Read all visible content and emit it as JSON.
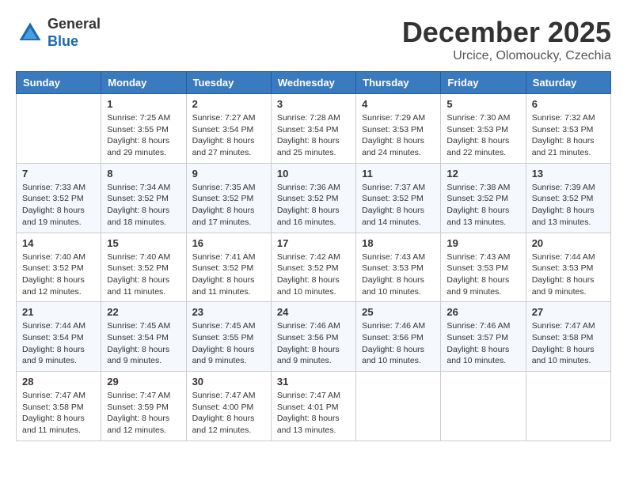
{
  "header": {
    "logo_general": "General",
    "logo_blue": "Blue",
    "month": "December 2025",
    "location": "Urcice, Olomoucky, Czechia"
  },
  "days_of_week": [
    "Sunday",
    "Monday",
    "Tuesday",
    "Wednesday",
    "Thursday",
    "Friday",
    "Saturday"
  ],
  "weeks": [
    [
      {
        "num": "",
        "info": ""
      },
      {
        "num": "1",
        "info": "Sunrise: 7:25 AM\nSunset: 3:55 PM\nDaylight: 8 hours\nand 29 minutes."
      },
      {
        "num": "2",
        "info": "Sunrise: 7:27 AM\nSunset: 3:54 PM\nDaylight: 8 hours\nand 27 minutes."
      },
      {
        "num": "3",
        "info": "Sunrise: 7:28 AM\nSunset: 3:54 PM\nDaylight: 8 hours\nand 25 minutes."
      },
      {
        "num": "4",
        "info": "Sunrise: 7:29 AM\nSunset: 3:53 PM\nDaylight: 8 hours\nand 24 minutes."
      },
      {
        "num": "5",
        "info": "Sunrise: 7:30 AM\nSunset: 3:53 PM\nDaylight: 8 hours\nand 22 minutes."
      },
      {
        "num": "6",
        "info": "Sunrise: 7:32 AM\nSunset: 3:53 PM\nDaylight: 8 hours\nand 21 minutes."
      }
    ],
    [
      {
        "num": "7",
        "info": "Sunrise: 7:33 AM\nSunset: 3:52 PM\nDaylight: 8 hours\nand 19 minutes."
      },
      {
        "num": "8",
        "info": "Sunrise: 7:34 AM\nSunset: 3:52 PM\nDaylight: 8 hours\nand 18 minutes."
      },
      {
        "num": "9",
        "info": "Sunrise: 7:35 AM\nSunset: 3:52 PM\nDaylight: 8 hours\nand 17 minutes."
      },
      {
        "num": "10",
        "info": "Sunrise: 7:36 AM\nSunset: 3:52 PM\nDaylight: 8 hours\nand 16 minutes."
      },
      {
        "num": "11",
        "info": "Sunrise: 7:37 AM\nSunset: 3:52 PM\nDaylight: 8 hours\nand 14 minutes."
      },
      {
        "num": "12",
        "info": "Sunrise: 7:38 AM\nSunset: 3:52 PM\nDaylight: 8 hours\nand 13 minutes."
      },
      {
        "num": "13",
        "info": "Sunrise: 7:39 AM\nSunset: 3:52 PM\nDaylight: 8 hours\nand 13 minutes."
      }
    ],
    [
      {
        "num": "14",
        "info": "Sunrise: 7:40 AM\nSunset: 3:52 PM\nDaylight: 8 hours\nand 12 minutes."
      },
      {
        "num": "15",
        "info": "Sunrise: 7:40 AM\nSunset: 3:52 PM\nDaylight: 8 hours\nand 11 minutes."
      },
      {
        "num": "16",
        "info": "Sunrise: 7:41 AM\nSunset: 3:52 PM\nDaylight: 8 hours\nand 11 minutes."
      },
      {
        "num": "17",
        "info": "Sunrise: 7:42 AM\nSunset: 3:52 PM\nDaylight: 8 hours\nand 10 minutes."
      },
      {
        "num": "18",
        "info": "Sunrise: 7:43 AM\nSunset: 3:53 PM\nDaylight: 8 hours\nand 10 minutes."
      },
      {
        "num": "19",
        "info": "Sunrise: 7:43 AM\nSunset: 3:53 PM\nDaylight: 8 hours\nand 9 minutes."
      },
      {
        "num": "20",
        "info": "Sunrise: 7:44 AM\nSunset: 3:53 PM\nDaylight: 8 hours\nand 9 minutes."
      }
    ],
    [
      {
        "num": "21",
        "info": "Sunrise: 7:44 AM\nSunset: 3:54 PM\nDaylight: 8 hours\nand 9 minutes."
      },
      {
        "num": "22",
        "info": "Sunrise: 7:45 AM\nSunset: 3:54 PM\nDaylight: 8 hours\nand 9 minutes."
      },
      {
        "num": "23",
        "info": "Sunrise: 7:45 AM\nSunset: 3:55 PM\nDaylight: 8 hours\nand 9 minutes."
      },
      {
        "num": "24",
        "info": "Sunrise: 7:46 AM\nSunset: 3:56 PM\nDaylight: 8 hours\nand 9 minutes."
      },
      {
        "num": "25",
        "info": "Sunrise: 7:46 AM\nSunset: 3:56 PM\nDaylight: 8 hours\nand 10 minutes."
      },
      {
        "num": "26",
        "info": "Sunrise: 7:46 AM\nSunset: 3:57 PM\nDaylight: 8 hours\nand 10 minutes."
      },
      {
        "num": "27",
        "info": "Sunrise: 7:47 AM\nSunset: 3:58 PM\nDaylight: 8 hours\nand 10 minutes."
      }
    ],
    [
      {
        "num": "28",
        "info": "Sunrise: 7:47 AM\nSunset: 3:58 PM\nDaylight: 8 hours\nand 11 minutes."
      },
      {
        "num": "29",
        "info": "Sunrise: 7:47 AM\nSunset: 3:59 PM\nDaylight: 8 hours\nand 12 minutes."
      },
      {
        "num": "30",
        "info": "Sunrise: 7:47 AM\nSunset: 4:00 PM\nDaylight: 8 hours\nand 12 minutes."
      },
      {
        "num": "31",
        "info": "Sunrise: 7:47 AM\nSunset: 4:01 PM\nDaylight: 8 hours\nand 13 minutes."
      },
      {
        "num": "",
        "info": ""
      },
      {
        "num": "",
        "info": ""
      },
      {
        "num": "",
        "info": ""
      }
    ]
  ]
}
